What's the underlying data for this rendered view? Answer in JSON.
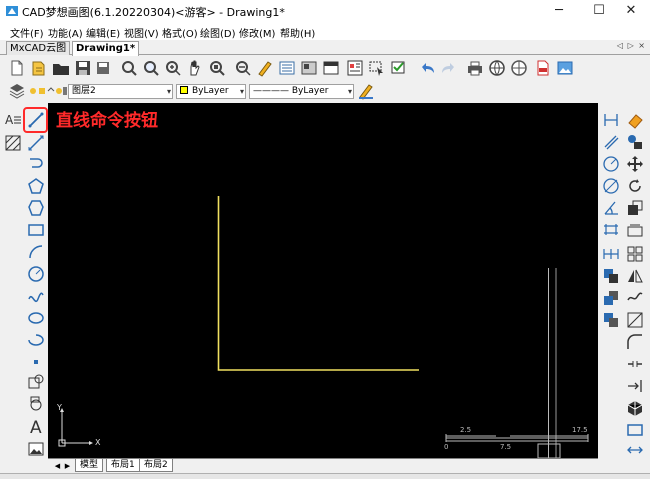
{
  "window": {
    "title": "CAD梦想画图(6.1.20220304)<游客> - Drawing1*",
    "minimize_glyph": "─",
    "maximize_glyph": "☐",
    "close_glyph": "✕"
  },
  "menu": {
    "items": [
      {
        "label": "文件(F)"
      },
      {
        "label": "功能(A)"
      },
      {
        "label": "编辑(E)"
      },
      {
        "label": "视图(V)"
      },
      {
        "label": "格式(O)"
      },
      {
        "label": "绘图(D)"
      },
      {
        "label": "修改(M)"
      },
      {
        "label": "帮助(H)"
      }
    ]
  },
  "tabs": {
    "items": [
      {
        "label": "MxCAD云图"
      },
      {
        "label": "Drawing1*"
      }
    ],
    "active_index": 1,
    "scroll_arrows": "◁ ▷ ×"
  },
  "layer_bar": {
    "layer_name": "图层2",
    "color_value": "ByLayer",
    "linetype_value": "———— ByLayer"
  },
  "canvas": {
    "annotation": "直线命令按钮",
    "background": "#000000",
    "line_color": "#f0e060",
    "annotation_color": "#ff2a2a",
    "ucs_y": "Y",
    "ucs_x": "X",
    "scale_labels": [
      "2.5",
      "17.5",
      "0",
      "7.5"
    ]
  },
  "layouts": {
    "items": [
      {
        "label": "模型"
      },
      {
        "label": "布局1"
      },
      {
        "label": "布局2"
      }
    ],
    "nav": [
      "◀",
      "▶"
    ]
  },
  "icons": {
    "highlighted_tool": "line-tool-icon",
    "highlight_color": "#ff2a2a"
  }
}
